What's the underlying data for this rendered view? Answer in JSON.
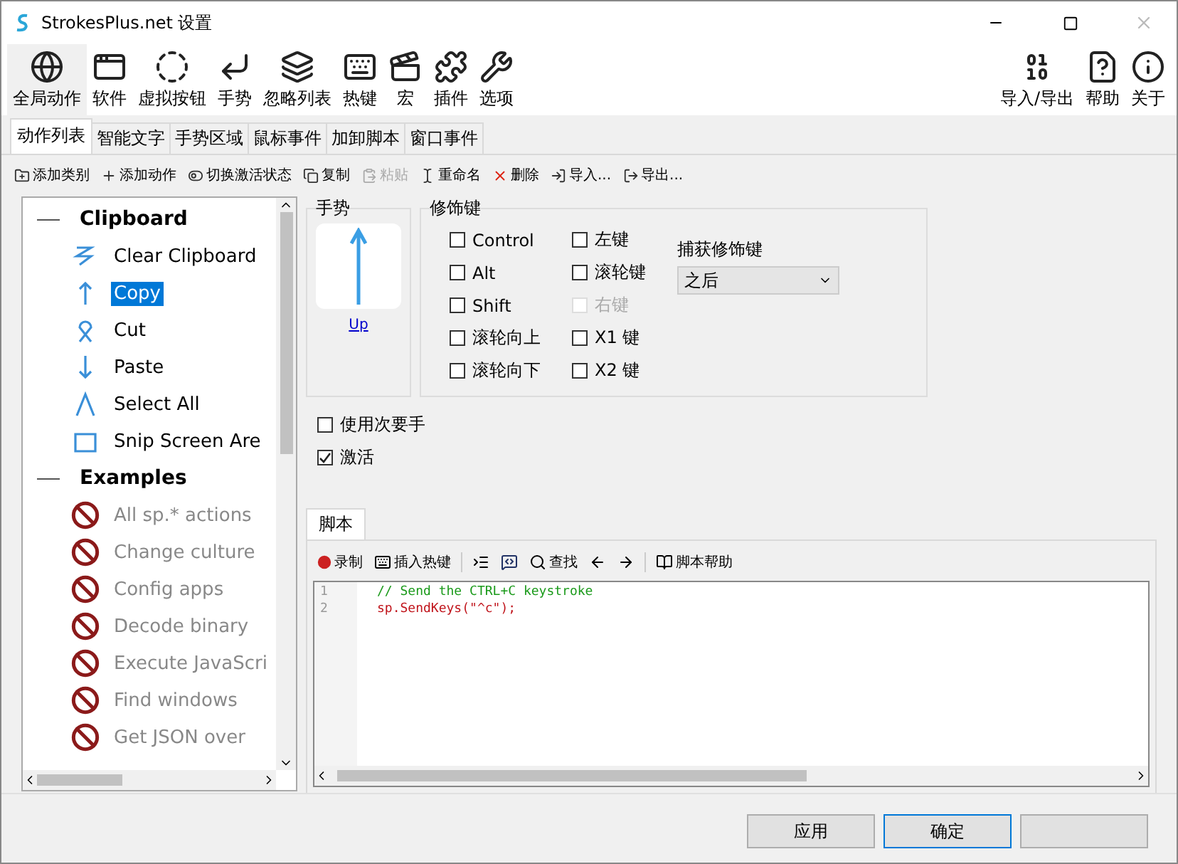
{
  "window": {
    "title": "StrokesPlus.net 设置"
  },
  "toolbar": [
    {
      "kind": "globe",
      "label": "全局动作",
      "selected": true
    },
    {
      "kind": "window",
      "label": "软件",
      "selected": false
    },
    {
      "kind": "ring",
      "label": "虚拟按钮",
      "selected": false
    },
    {
      "kind": "gesture",
      "label": "手势",
      "selected": false
    },
    {
      "kind": "stack",
      "label": "忽略列表",
      "selected": false
    },
    {
      "kind": "hotkey",
      "label": "热键",
      "selected": false
    },
    {
      "kind": "macro",
      "label": "宏",
      "selected": false
    },
    {
      "kind": "plugin",
      "label": "插件",
      "selected": false
    },
    {
      "kind": "wrench",
      "label": "选项",
      "selected": false
    }
  ],
  "toolbar_right": [
    {
      "kind": "io",
      "label": "导入/导出"
    },
    {
      "kind": "help",
      "label": "帮助"
    },
    {
      "kind": "about",
      "label": "关于"
    }
  ],
  "tabs": [
    {
      "label": "动作列表",
      "selected": true
    },
    {
      "label": "智能文字",
      "selected": false
    },
    {
      "label": "手势区域",
      "selected": false
    },
    {
      "label": "鼠标事件",
      "selected": false
    },
    {
      "label": "加卸脚本",
      "selected": false
    },
    {
      "label": "窗口事件",
      "selected": false
    }
  ],
  "actions": [
    {
      "kind": "addcat",
      "label": "添加类别",
      "disabled": false
    },
    {
      "kind": "add",
      "label": "添加动作",
      "disabled": false
    },
    {
      "kind": "toggle",
      "label": "切换激活状态",
      "disabled": false
    },
    {
      "kind": "copy",
      "label": "复制",
      "disabled": false
    },
    {
      "kind": "paste",
      "label": "粘贴",
      "disabled": true
    },
    {
      "kind": "rename",
      "label": "重命名",
      "disabled": false
    },
    {
      "kind": "delete",
      "label": "删除",
      "disabled": false
    },
    {
      "kind": "import",
      "label": "导入...",
      "disabled": false
    },
    {
      "kind": "export",
      "label": "导出...",
      "disabled": false
    }
  ],
  "tree": [
    {
      "label": "Clipboard",
      "expanded": true,
      "children": [
        {
          "label": "Clear Clipboard",
          "kind": "zigzag",
          "disabled": false,
          "selected": false
        },
        {
          "label": "Copy",
          "kind": "up",
          "disabled": false,
          "selected": true
        },
        {
          "label": "Cut",
          "kind": "loop",
          "disabled": false,
          "selected": false
        },
        {
          "label": "Paste",
          "kind": "down",
          "disabled": false,
          "selected": false
        },
        {
          "label": "Select All",
          "kind": "caret",
          "disabled": false,
          "selected": false
        },
        {
          "label": "Snip Screen Are",
          "kind": "rect",
          "disabled": false,
          "selected": false
        }
      ]
    },
    {
      "label": "Examples",
      "expanded": true,
      "children": [
        {
          "label": "All sp.* actions",
          "kind": "ban",
          "disabled": true,
          "selected": false
        },
        {
          "label": "Change culture",
          "kind": "ban",
          "disabled": true,
          "selected": false
        },
        {
          "label": "Config apps",
          "kind": "ban",
          "disabled": true,
          "selected": false
        },
        {
          "label": "Decode binary",
          "kind": "ban",
          "disabled": true,
          "selected": false
        },
        {
          "label": "Execute JavaScri",
          "kind": "ban",
          "disabled": true,
          "selected": false
        },
        {
          "label": "Find windows",
          "kind": "ban",
          "disabled": true,
          "selected": false
        },
        {
          "label": "Get JSON over",
          "kind": "ban",
          "disabled": true,
          "selected": false
        }
      ]
    }
  ],
  "gesture": {
    "title": "手势",
    "name": "Up"
  },
  "modifiers": {
    "title": "修饰键",
    "columns": [
      [
        {
          "label": "Control",
          "checked": false,
          "disabled": false
        },
        {
          "label": "Alt",
          "checked": false,
          "disabled": false
        },
        {
          "label": "Shift",
          "checked": false,
          "disabled": false
        },
        {
          "label": "滚轮向上",
          "checked": false,
          "disabled": false
        },
        {
          "label": "滚轮向下",
          "checked": false,
          "disabled": false
        }
      ],
      [
        {
          "label": "左键",
          "checked": false,
          "disabled": false
        },
        {
          "label": "滚轮键",
          "checked": false,
          "disabled": false
        },
        {
          "label": "右键",
          "checked": false,
          "disabled": true
        },
        {
          "label": "X1 键",
          "checked": false,
          "disabled": false
        },
        {
          "label": "X2 键",
          "checked": false,
          "disabled": false
        }
      ]
    ],
    "capture_label": "捕获修饰键",
    "capture_value": "之后"
  },
  "options": [
    {
      "label": "使用次要手",
      "checked": false
    },
    {
      "label": "激活",
      "checked": true
    }
  ],
  "script": {
    "tab": "脚本",
    "tools": [
      {
        "kind": "record",
        "label": "录制"
      },
      {
        "kind": "hotkey",
        "label": "插入热键"
      },
      {
        "kind": "sep"
      },
      {
        "kind": "indent"
      },
      {
        "kind": "comment"
      },
      {
        "kind": "find",
        "label": "查找"
      },
      {
        "kind": "back"
      },
      {
        "kind": "forward"
      },
      {
        "kind": "sep"
      },
      {
        "kind": "help",
        "label": "脚本帮助"
      }
    ],
    "lines": [
      {
        "number": "1",
        "kind": "comment",
        "text": "// Send the CTRL+C keystroke"
      },
      {
        "number": "2",
        "kind": "code",
        "text": "sp.SendKeys(\"^c\");"
      }
    ]
  },
  "buttons": [
    {
      "label": "应用",
      "kind": "button",
      "focused": false
    },
    {
      "label": "确定",
      "kind": "button",
      "focused": true
    },
    {
      "kind": "button",
      "focused": false
    }
  ]
}
